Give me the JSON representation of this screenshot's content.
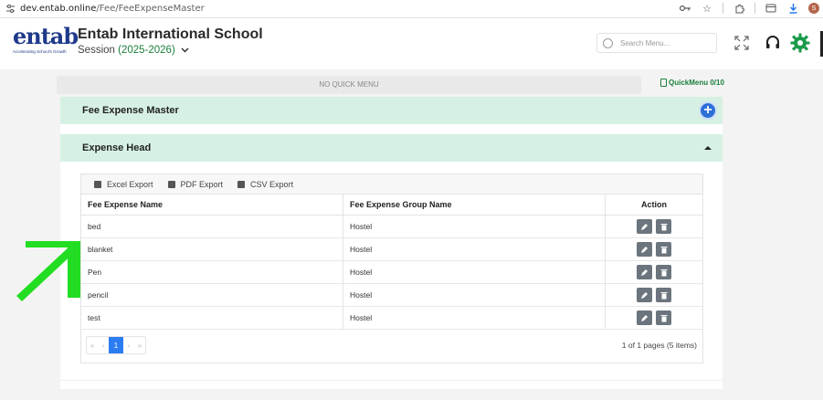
{
  "browser": {
    "url_host": "dev.entab.online",
    "url_path": "/Fee/FeeExpenseMaster",
    "profile_initial": "S"
  },
  "header": {
    "logo_text": "entab",
    "logo_tagline": "Accelerating School's Growth",
    "school_name": "Entab International School",
    "session_label": "Session",
    "session_year": "(2025-2026)",
    "search_placeholder": "Search Menu..."
  },
  "quick_menu": {
    "bar_text": "NO QUICK MENU",
    "link_text": "QuickMenu 0/10"
  },
  "sections": {
    "master_title": "Fee Expense Master",
    "head_title": "Expense Head"
  },
  "toolbar": {
    "excel": "Excel Export",
    "pdf": "PDF Export",
    "csv": "CSV Export"
  },
  "table": {
    "columns": [
      "Fee Expense Name",
      "Fee Expense Group Name",
      "Action"
    ],
    "rows": [
      {
        "name": "bed",
        "group": "Hostel"
      },
      {
        "name": "blanket",
        "group": "Hostel"
      },
      {
        "name": "Pen",
        "group": "Hostel"
      },
      {
        "name": "pencil",
        "group": "Hostel"
      },
      {
        "name": "test",
        "group": "Hostel"
      }
    ]
  },
  "pager": {
    "first": "«",
    "prev": "‹",
    "current": "1",
    "next": "›",
    "last": "»",
    "info": "1 of 1 pages (5 items)"
  },
  "colors": {
    "section_bg": "#d6f1e3",
    "accent_green": "#1a7f3c",
    "add_blue": "#2e6fd8",
    "pager_active": "#2b7cf2",
    "action_gray": "#6c757d",
    "arrow_green": "#22dd22"
  },
  "icons": [
    "site-settings-icon",
    "key-icon",
    "star-icon",
    "extensions-icon",
    "tab-search-icon",
    "download-icon",
    "fullscreen-icon",
    "headset-icon",
    "gear-icon",
    "add-icon",
    "chevron-up-icon",
    "excel-icon",
    "pdf-icon",
    "csv-icon",
    "edit-icon",
    "delete-icon",
    "green-arrow-annotation"
  ]
}
